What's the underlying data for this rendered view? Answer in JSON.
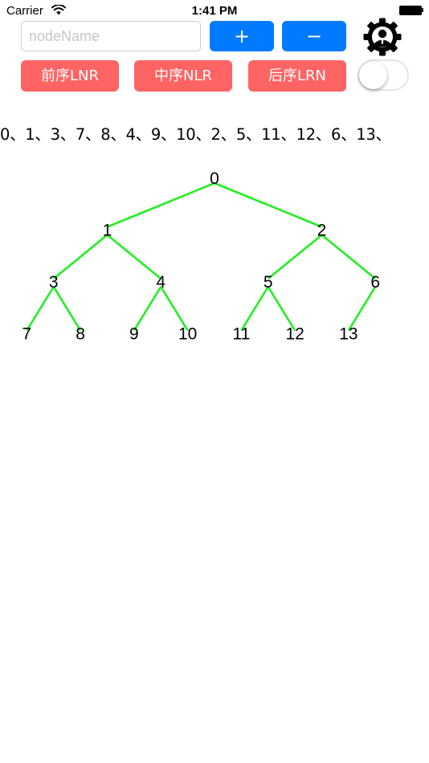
{
  "status_bar": {
    "carrier": "Carrier",
    "time": "1:41 PM"
  },
  "controls": {
    "node_input": {
      "value": "",
      "placeholder": "nodeName"
    },
    "add_label": "+",
    "remove_label": "−",
    "preorder_label": "前序LNR",
    "inorder_label": "中序NLR",
    "postorder_label": "后序LRN",
    "toggle_on": false
  },
  "traversal_text": "0、1、3、7、8、4、9、10、2、5、11、12、6、13、",
  "tree": {
    "edge_color": "#22ee22",
    "nodes": [
      {
        "id": "0",
        "label": "0",
        "parent": null
      },
      {
        "id": "1",
        "label": "1",
        "parent": "0"
      },
      {
        "id": "2",
        "label": "2",
        "parent": "0"
      },
      {
        "id": "3",
        "label": "3",
        "parent": "1"
      },
      {
        "id": "4",
        "label": "4",
        "parent": "1"
      },
      {
        "id": "5",
        "label": "5",
        "parent": "2"
      },
      {
        "id": "6",
        "label": "6",
        "parent": "2"
      },
      {
        "id": "7",
        "label": "7",
        "parent": "3"
      },
      {
        "id": "8",
        "label": "8",
        "parent": "3"
      },
      {
        "id": "9",
        "label": "9",
        "parent": "4"
      },
      {
        "id": "10",
        "label": "10",
        "parent": "4"
      },
      {
        "id": "11",
        "label": "11",
        "parent": "5"
      },
      {
        "id": "12",
        "label": "12",
        "parent": "5"
      },
      {
        "id": "13",
        "label": "13",
        "parent": "6"
      }
    ]
  },
  "colors": {
    "primary_blue": "#007aff",
    "traversal_red": "#ff6464"
  },
  "icons": {
    "settings": "gear-user-icon",
    "wifi": "wifi-icon",
    "battery": "battery-icon"
  }
}
